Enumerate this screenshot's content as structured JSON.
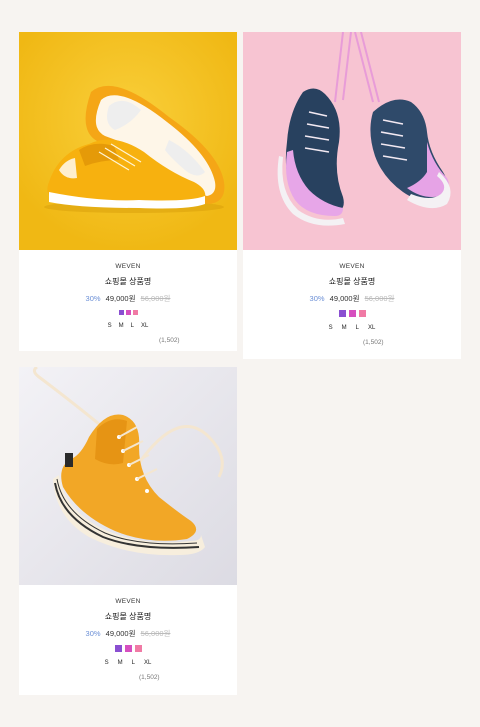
{
  "products": [
    {
      "brand": "WEVEN",
      "name": "쇼핑몰 상품명",
      "discount": "30%",
      "price": "49,000원",
      "original_price": "56,000원",
      "colors": [
        "#8a4fd1",
        "#d64fbf",
        "#f07aa5"
      ],
      "sizes": [
        "S",
        "M",
        "L",
        "XL"
      ],
      "reviews": "(1,502)",
      "image": "yellow-sneakers"
    },
    {
      "brand": "WEVEN",
      "name": "쇼핑몰 상품명",
      "discount": "30%",
      "price": "49,000원",
      "original_price": "56,000원",
      "colors": [
        "#8a4fd1",
        "#d64fbf",
        "#f07aa5"
      ],
      "sizes": [
        "S",
        "M",
        "L",
        "XL"
      ],
      "reviews": "(1,502)",
      "image": "navy-hanging-sneakers"
    },
    {
      "brand": "WEVEN",
      "name": "쇼핑몰 상품명",
      "discount": "30%",
      "price": "49,000원",
      "original_price": "56,000원",
      "colors": [
        "#8a4fd1",
        "#d64fbf",
        "#f07aa5"
      ],
      "sizes": [
        "S",
        "M",
        "L",
        "XL"
      ],
      "reviews": "(1,502)",
      "image": "orange-hightop-sneaker"
    }
  ]
}
